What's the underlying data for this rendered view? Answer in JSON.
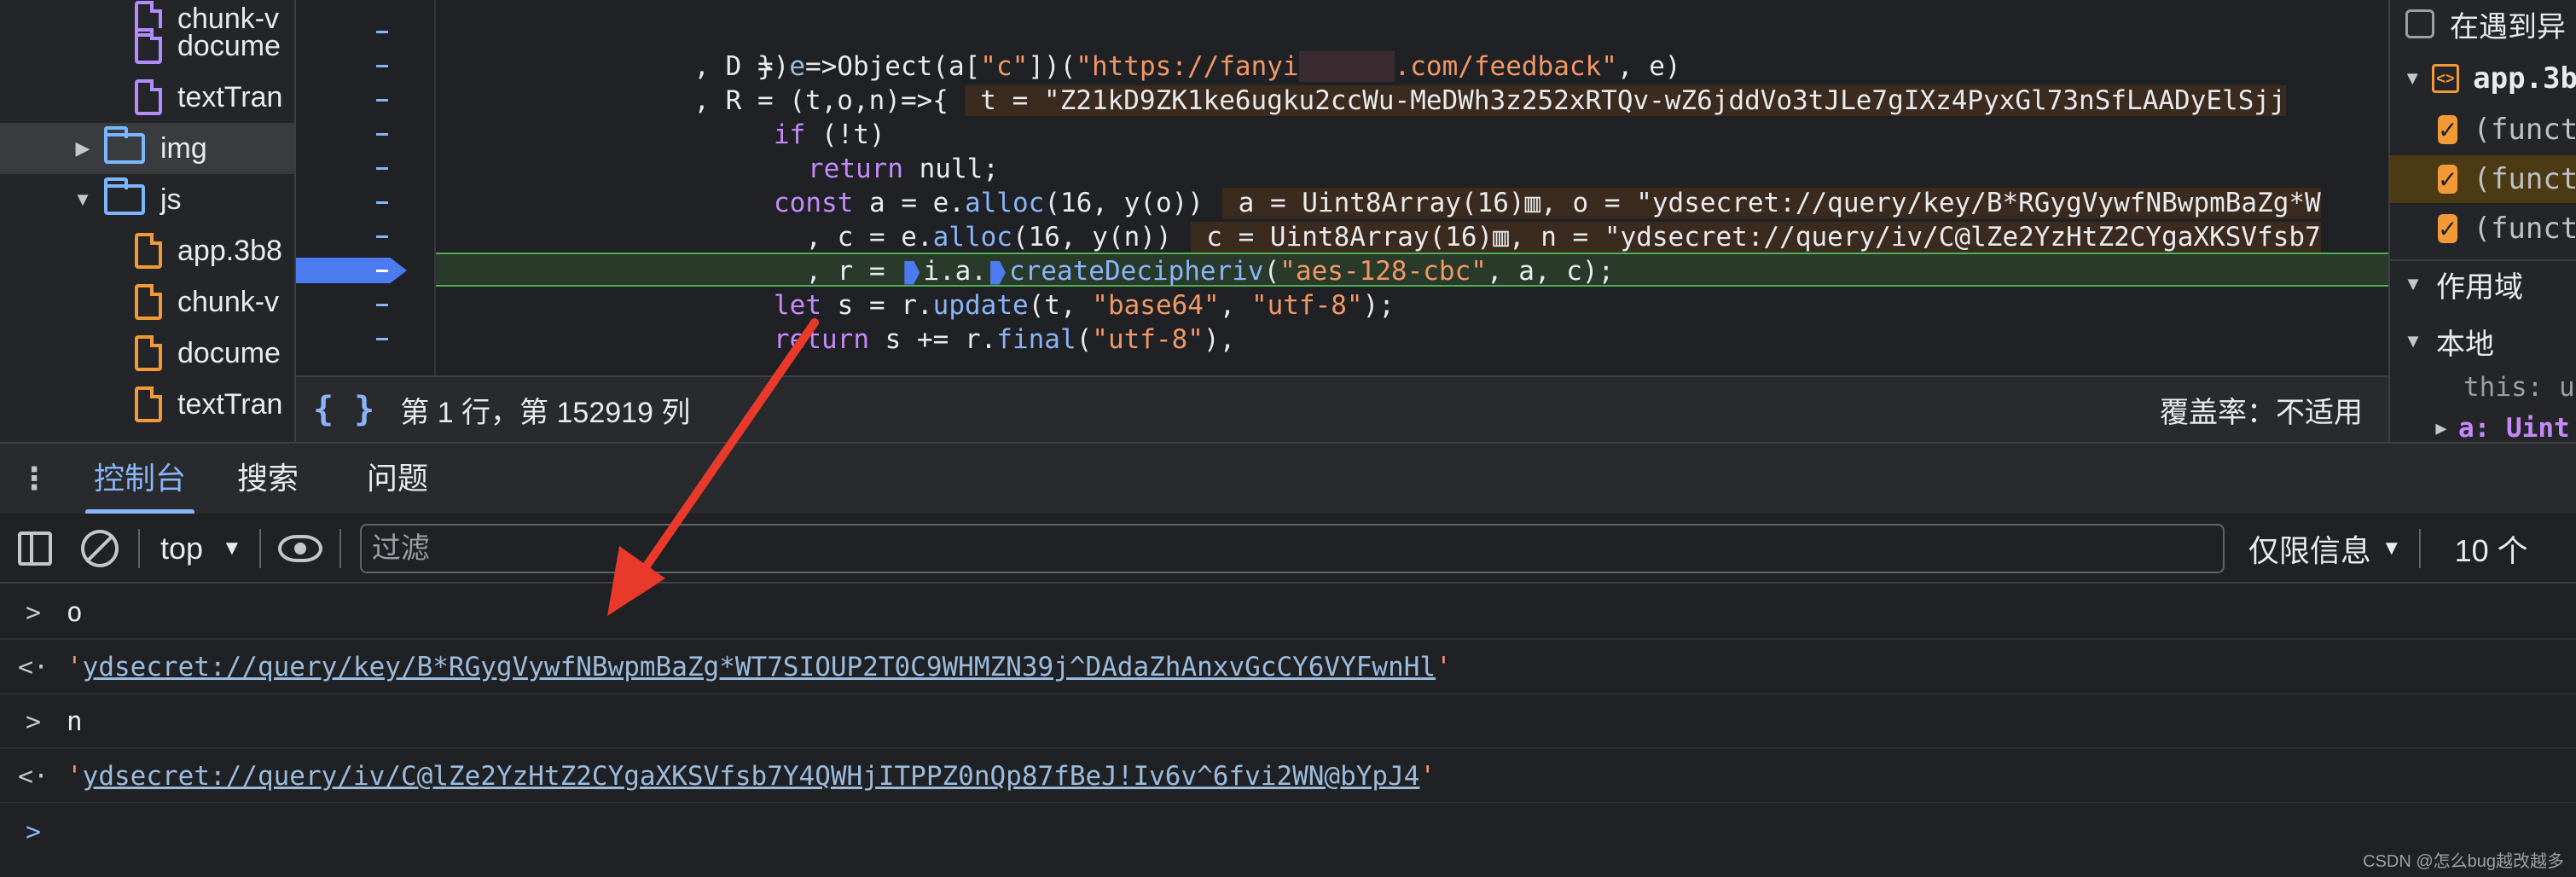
{
  "file_tree": {
    "items": [
      {
        "name": "chunk-v",
        "kind": "file-purple",
        "depth": 2
      },
      {
        "name": "docume",
        "kind": "file-purple",
        "depth": 2
      },
      {
        "name": "textTran",
        "kind": "file-purple",
        "depth": 2
      },
      {
        "name": "img",
        "kind": "folder",
        "depth": 1,
        "expanded": false,
        "selected": true
      },
      {
        "name": "js",
        "kind": "folder",
        "depth": 1,
        "expanded": true
      },
      {
        "name": "app.3b8",
        "kind": "file-orange",
        "depth": 2
      },
      {
        "name": "chunk-v",
        "kind": "file-orange",
        "depth": 2
      },
      {
        "name": "docume",
        "kind": "file-orange",
        "depth": 2
      },
      {
        "name": "textTran",
        "kind": "file-orange",
        "depth": 2
      }
    ]
  },
  "editor": {
    "lines": {
      "l0": "})",
      "l1_a": "  , D = ",
      "l1_b": "e",
      "l1_c": "=>Object(a[",
      "l1_d": "\"c\"",
      "l1_e": "])(",
      "l1_f": "\"https://fanyi",
      "l1_g": "      ",
      "l1_h": ".com/feedback\"",
      "l1_i": ", e)",
      "l2_a": "  , R = (t,o,n)=>{ ",
      "l2_inl": " t = \"Z21kD9ZK1ke6ugku2ccWu-MeDWh3z252xRTQv-wZ6jddVo3tJLe7gIXz4PyxGl73nSfLAADyElSjj",
      "l3_a": "if",
      "l3_b": " (!t)",
      "l4_a": "return",
      "l4_b": " null;",
      "l5_a": "const",
      "l5_b": " a = e.",
      "l5_c": "alloc",
      "l5_d": "(16, y(o))",
      "l5_inl_a": " a = Uint8Array(16)",
      "l5_inl_b": ", o = \"ydsecret://query/key/B*RGygVywfNBwpmBaZg*W",
      "l6_a": "  , c = e.",
      "l6_c": "alloc",
      "l6_d": "(16, y(n))",
      "l6_inl_a": " c = Uint8Array(16)",
      "l6_inl_b": ", n = \"ydsecret://query/iv/C@lZe2YzHtZ2CYgaXKSVfsb7",
      "l7_a": "  , r = ",
      "l7_b": "i.a.",
      "l7_c": "createDecipheriv",
      "l7_d": "(",
      "l7_e": "\"aes-128-cbc\"",
      "l7_f": ", a, c);",
      "l8_a": "let",
      "l8_b": " s = r.",
      "l8_c": "update",
      "l8_d": "(t, ",
      "l8_e": "\"base64\"",
      "l8_f": ", ",
      "l8_g": "\"utf-8\"",
      "l8_h": ");",
      "l9_a": "return",
      "l9_b": " s += r.",
      "l9_c": "final",
      "l9_d": "(",
      "l9_e": "\"utf-8\"",
      "l9_f": "),"
    },
    "status": {
      "cursor_position": "第 1 行，第 152919 列",
      "coverage": "覆盖率：不适用"
    }
  },
  "right_pane": {
    "pause_on_exception_label": "在遇到异",
    "script_name": "app.3b",
    "call_items": [
      "(funct",
      "(funct",
      "(funct"
    ],
    "scope_label": "作用域",
    "local_label": "本地",
    "this_label": "this: u",
    "a_label": "a: Uint"
  },
  "drawer": {
    "tabs": [
      "控制台",
      "搜索",
      "问题"
    ],
    "toolbar": {
      "context": "top",
      "filter_placeholder": "过滤",
      "levels": "仅限信息",
      "issues": "10 个"
    },
    "console": [
      {
        "type": "input",
        "text": "o"
      },
      {
        "type": "output",
        "value": "ydsecret://query/key/B*RGygVywfNBwpmBaZg*WT7SIOUP2T0C9WHMZN39j^DAdaZhAnxvGcCY6VYFwnHl"
      },
      {
        "type": "input",
        "text": "n"
      },
      {
        "type": "output",
        "value": "ydsecret://query/iv/C@lZe2YzHtZ2CYgaXKSVfsb7Y4QWHjITPPZ0nQp87fBeJ!Iv6v^6fvi2WN@bYpJ4"
      }
    ],
    "watermark": "CSDN @怎么bug越改越多"
  },
  "colors": {
    "accent": "#8ab4f8",
    "string": "#f29766",
    "keyword": "#c58af9",
    "current_line": "#293a2b",
    "arrow": "#e8392b"
  }
}
